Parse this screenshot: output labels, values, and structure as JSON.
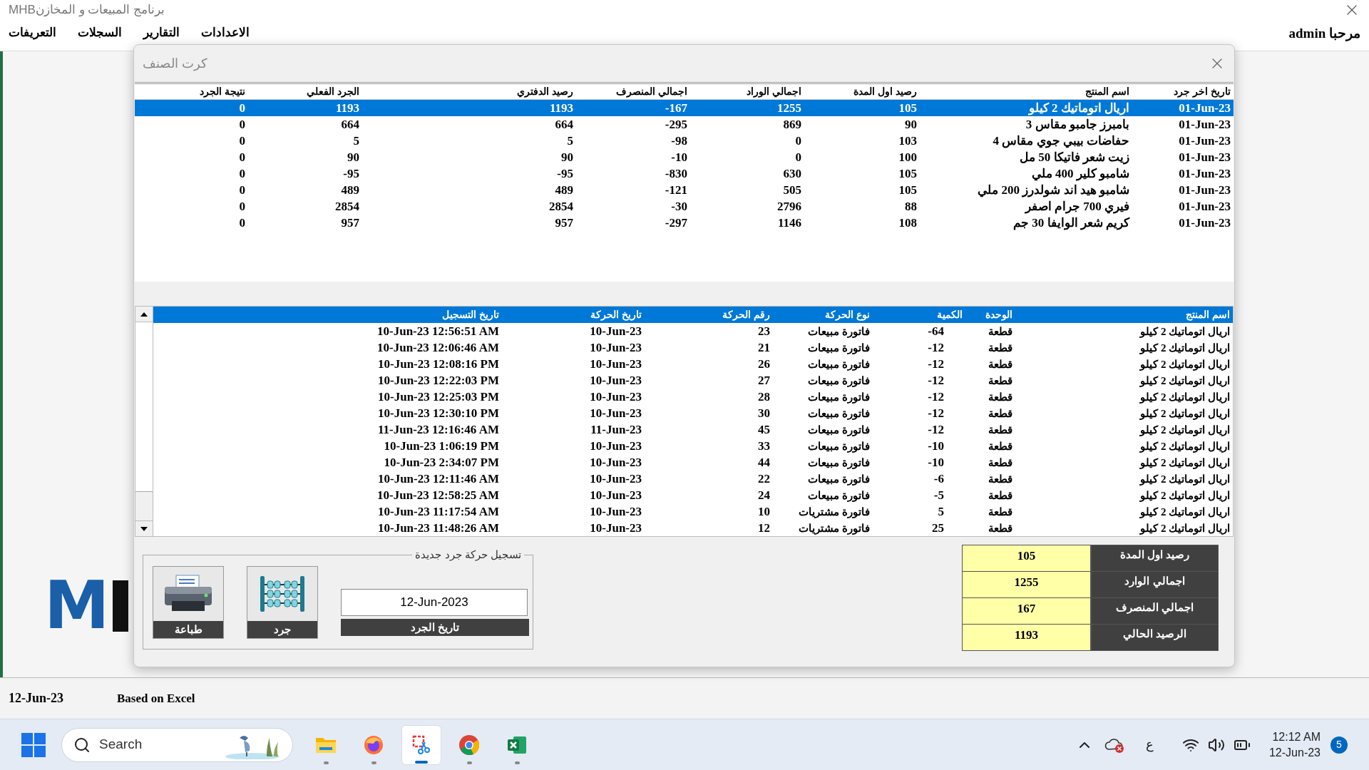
{
  "window": {
    "title": "برنامج المبيعات و المخازنMHB"
  },
  "menu": [
    {
      "label": "الاعدادات"
    },
    {
      "label": "التقارير"
    },
    {
      "label": "السجلات"
    },
    {
      "label": "التعريفات"
    }
  ],
  "welcome": "مرحبا admin",
  "logo": {
    "text": "M"
  },
  "dialog": {
    "title": "كرت الصنف"
  },
  "stock_table": {
    "columns": [
      "تاريخ اخر جرد",
      "اسم المنتج",
      "رصيد اول المدة",
      "اجمالي الوراد",
      "اجمالي المنصرف",
      "رصيد الدفتري",
      "الجرد الفعلي",
      "نتيجة الجرد"
    ],
    "rows": [
      {
        "selected": true,
        "cells": [
          "01-Jun-23",
          "اريال اتوماتيك 2 كيلو",
          "105",
          "1255",
          "-167",
          "1193",
          "1193",
          "0"
        ]
      },
      {
        "selected": false,
        "cells": [
          "01-Jun-23",
          "بامبرز جامبو مقاس 3",
          "90",
          "869",
          "-295",
          "664",
          "664",
          "0"
        ]
      },
      {
        "selected": false,
        "cells": [
          "01-Jun-23",
          "حفاضات بيبي جوي مقاس 4",
          "103",
          "0",
          "-98",
          "5",
          "5",
          "0"
        ]
      },
      {
        "selected": false,
        "cells": [
          "01-Jun-23",
          "زيت شعر فاتيكا 50 مل",
          "100",
          "0",
          "-10",
          "90",
          "90",
          "0"
        ]
      },
      {
        "selected": false,
        "cells": [
          "01-Jun-23",
          "شامبو كلير 400 ملي",
          "105",
          "630",
          "-830",
          "-95",
          "-95",
          "0"
        ]
      },
      {
        "selected": false,
        "cells": [
          "01-Jun-23",
          "شامبو هيد اند شولدرز 200 ملي",
          "105",
          "505",
          "-121",
          "489",
          "489",
          "0"
        ]
      },
      {
        "selected": false,
        "cells": [
          "01-Jun-23",
          "فيري 700 جرام اصفر",
          "88",
          "2796",
          "-30",
          "2854",
          "2854",
          "0"
        ]
      },
      {
        "selected": false,
        "cells": [
          "01-Jun-23",
          "كريم شعر الوايفا 30 جم",
          "108",
          "1146",
          "-297",
          "957",
          "957",
          "0"
        ]
      }
    ]
  },
  "movements_table": {
    "columns": [
      "اسم المنتج",
      "الوحدة",
      "الكمية",
      "نوع الحركة",
      "رقم الحركة",
      "تاريخ الحركة",
      "تاريخ التسجيل"
    ],
    "rows": [
      [
        "اريال اتوماتيك 2 كيلو",
        "قطعة",
        "-64",
        "فاتورة مبيعات",
        "23",
        "10-Jun-23",
        "10-Jun-23 12:56:51 AM"
      ],
      [
        "اريال اتوماتيك 2 كيلو",
        "قطعة",
        "-12",
        "فاتورة مبيعات",
        "21",
        "10-Jun-23",
        "10-Jun-23 12:06:46 AM"
      ],
      [
        "اريال اتوماتيك 2 كيلو",
        "قطعة",
        "-12",
        "فاتورة مبيعات",
        "26",
        "10-Jun-23",
        "10-Jun-23 12:08:16 PM"
      ],
      [
        "اريال اتوماتيك 2 كيلو",
        "قطعة",
        "-12",
        "فاتورة مبيعات",
        "27",
        "10-Jun-23",
        "10-Jun-23 12:22:03 PM"
      ],
      [
        "اريال اتوماتيك 2 كيلو",
        "قطعة",
        "-12",
        "فاتورة مبيعات",
        "28",
        "10-Jun-23",
        "10-Jun-23 12:25:03 PM"
      ],
      [
        "اريال اتوماتيك 2 كيلو",
        "قطعة",
        "-12",
        "فاتورة مبيعات",
        "30",
        "10-Jun-23",
        "10-Jun-23 12:30:10 PM"
      ],
      [
        "اريال اتوماتيك 2 كيلو",
        "قطعة",
        "-12",
        "فاتورة مبيعات",
        "45",
        "11-Jun-23",
        "11-Jun-23 12:16:46 AM"
      ],
      [
        "اريال اتوماتيك 2 كيلو",
        "قطعة",
        "-10",
        "فاتورة مبيعات",
        "33",
        "10-Jun-23",
        "10-Jun-23 1:06:19 PM"
      ],
      [
        "اريال اتوماتيك 2 كيلو",
        "قطعة",
        "-10",
        "فاتورة مبيعات",
        "44",
        "10-Jun-23",
        "10-Jun-23 2:34:07 PM"
      ],
      [
        "اريال اتوماتيك 2 كيلو",
        "قطعة",
        "-6",
        "فاتورة مبيعات",
        "22",
        "10-Jun-23",
        "10-Jun-23 12:11:46 AM"
      ],
      [
        "اريال اتوماتيك 2 كيلو",
        "قطعة",
        "-5",
        "فاتورة مبيعات",
        "24",
        "10-Jun-23",
        "10-Jun-23 12:58:25 AM"
      ],
      [
        "اريال اتوماتيك 2 كيلو",
        "قطعة",
        "5",
        "فاتورة مشتريات",
        "10",
        "10-Jun-23",
        "10-Jun-23 11:17:54 AM"
      ],
      [
        "اريال اتوماتيك 2 كيلو",
        "قطعة",
        "25",
        "فاتورة مشتريات",
        "12",
        "10-Jun-23",
        "10-Jun-23 11:48:26 AM"
      ]
    ]
  },
  "new_count": {
    "legend": "تسجيل حركة جرد جديدة",
    "buttons": [
      {
        "kind": "count",
        "label": "جرد"
      },
      {
        "kind": "print",
        "label": "طباعة"
      }
    ],
    "date_field": {
      "value": "12-Jun-2023",
      "label": "تاريخ الجرد"
    }
  },
  "summary": [
    {
      "label": "رصيد اول المدة",
      "value": "105"
    },
    {
      "label": "اجمالي الوارد",
      "value": "1255"
    },
    {
      "label": "اجمالي المنصرف",
      "value": "167"
    },
    {
      "label": "الرصيد الحالي",
      "value": "1193"
    }
  ],
  "status_bar": {
    "date": "12-Jun-23",
    "text": "Based on Excel"
  },
  "taskbar": {
    "search_placeholder": "Search",
    "apps": [
      {
        "kind": "folder",
        "selected": false
      },
      {
        "kind": "firefox",
        "selected": false
      },
      {
        "kind": "snipping",
        "selected": true
      },
      {
        "kind": "chrome",
        "selected": false
      },
      {
        "kind": "excel",
        "selected": false
      }
    ],
    "language": "ع",
    "time": "12:12 AM",
    "date": "12-Jun-23",
    "notifications": "5"
  }
}
